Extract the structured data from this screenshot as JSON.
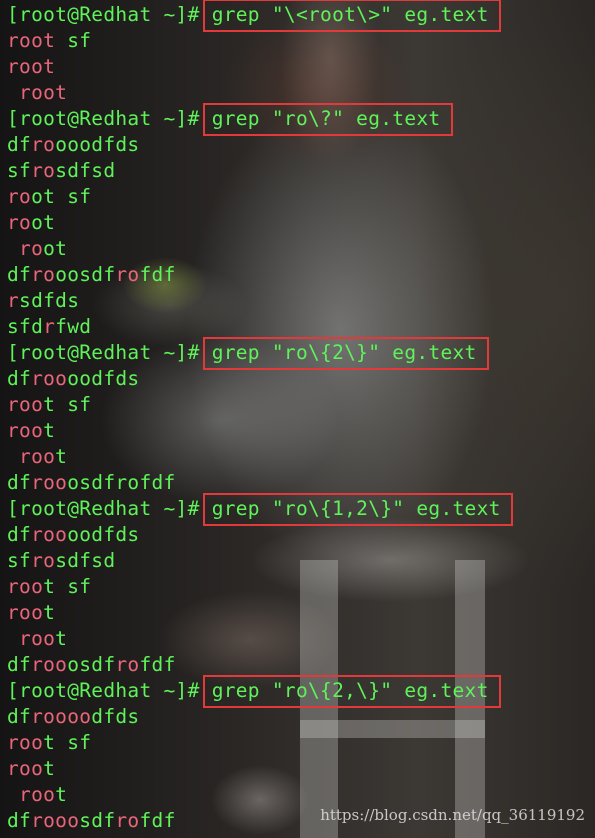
{
  "prompt": "[root@Redhat ~]# ",
  "blocks": [
    {
      "command": "grep \"\\<root\\>\" eg.text",
      "output": [
        [
          [
            "root",
            "p"
          ],
          [
            " sf",
            "g"
          ]
        ],
        [
          [
            "root",
            "p"
          ]
        ],
        [
          [
            " ",
            "g"
          ],
          [
            "root",
            "p"
          ]
        ]
      ]
    },
    {
      "command": "grep \"ro\\?\" eg.text",
      "output": [
        [
          [
            "df",
            "g"
          ],
          [
            "ro",
            "p"
          ],
          [
            "ooodfds",
            "g"
          ]
        ],
        [
          [
            "sf",
            "g"
          ],
          [
            "ro",
            "p"
          ],
          [
            "sdfsd",
            "g"
          ]
        ],
        [
          [
            "ro",
            "p"
          ],
          [
            "ot sf",
            "g"
          ]
        ],
        [
          [
            "ro",
            "p"
          ],
          [
            "ot",
            "g"
          ]
        ],
        [
          [
            " ",
            "g"
          ],
          [
            "ro",
            "p"
          ],
          [
            "ot",
            "g"
          ]
        ],
        [
          [
            "df",
            "g"
          ],
          [
            "ro",
            "p"
          ],
          [
            "oosdf",
            "g"
          ],
          [
            "ro",
            "p"
          ],
          [
            "fdf",
            "g"
          ]
        ],
        [
          [
            "r",
            "p"
          ],
          [
            "sdfds",
            "g"
          ]
        ],
        [
          [
            "sfd",
            "g"
          ],
          [
            "r",
            "p"
          ],
          [
            "fwd",
            "g"
          ]
        ]
      ]
    },
    {
      "command": "grep \"ro\\{2\\}\" eg.text",
      "output": [
        [
          [
            "df",
            "g"
          ],
          [
            "roo",
            "p"
          ],
          [
            "oodfds",
            "g"
          ]
        ],
        [
          [
            "roo",
            "p"
          ],
          [
            "t sf",
            "g"
          ]
        ],
        [
          [
            "roo",
            "p"
          ],
          [
            "t",
            "g"
          ]
        ],
        [
          [
            " ",
            "g"
          ],
          [
            "roo",
            "p"
          ],
          [
            "t",
            "g"
          ]
        ],
        [
          [
            "df",
            "g"
          ],
          [
            "roo",
            "p"
          ],
          [
            "osdfrofdf",
            "g"
          ]
        ]
      ]
    },
    {
      "command": "grep \"ro\\{1,2\\}\" eg.text",
      "output": [
        [
          [
            "df",
            "g"
          ],
          [
            "roo",
            "p"
          ],
          [
            "oodfds",
            "g"
          ]
        ],
        [
          [
            "sf",
            "g"
          ],
          [
            "ro",
            "p"
          ],
          [
            "sdfsd",
            "g"
          ]
        ],
        [
          [
            "roo",
            "p"
          ],
          [
            "t sf",
            "g"
          ]
        ],
        [
          [
            "roo",
            "p"
          ],
          [
            "t",
            "g"
          ]
        ],
        [
          [
            " ",
            "g"
          ],
          [
            "roo",
            "p"
          ],
          [
            "t",
            "g"
          ]
        ],
        [
          [
            "df",
            "g"
          ],
          [
            "roo",
            "p"
          ],
          [
            "osdf",
            "g"
          ],
          [
            "ro",
            "p"
          ],
          [
            "fdf",
            "g"
          ]
        ]
      ]
    },
    {
      "command": "grep \"ro\\{2,\\}\" eg.text",
      "output": [
        [
          [
            "df",
            "g"
          ],
          [
            "roooo",
            "p"
          ],
          [
            "dfds",
            "g"
          ]
        ],
        [
          [
            "roo",
            "p"
          ],
          [
            "t sf",
            "g"
          ]
        ],
        [
          [
            "roo",
            "p"
          ],
          [
            "t",
            "g"
          ]
        ],
        [
          [
            " ",
            "g"
          ],
          [
            "roo",
            "p"
          ],
          [
            "t",
            "g"
          ]
        ],
        [
          [
            "df",
            "g"
          ],
          [
            "rooo",
            "p"
          ],
          [
            "sdf",
            "g"
          ],
          [
            "ro",
            "p"
          ],
          [
            "fdf",
            "g"
          ]
        ]
      ]
    }
  ],
  "watermark": "https://blog.csdn.net/qq_36119192",
  "colors": {
    "prompt_and_text": "#5ff35a",
    "match_highlight": "#e9667a",
    "annotation_box": "#e23a3a"
  }
}
